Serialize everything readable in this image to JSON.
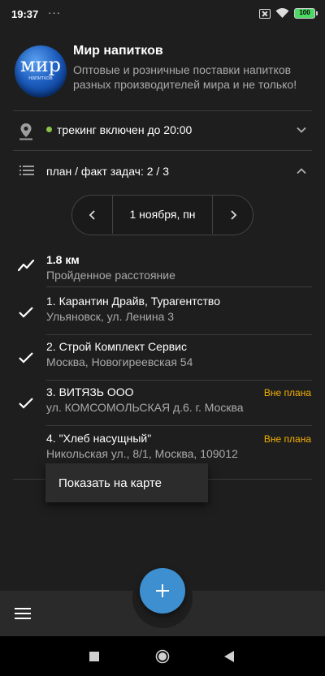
{
  "status_bar": {
    "time": "19:37",
    "dots": "···",
    "battery": "100"
  },
  "header": {
    "logo_main": "мир",
    "logo_sub": "напитков",
    "title": "Мир напитков",
    "description": "Оптовые и розничные поставки напитков разных производителей мира и не только!"
  },
  "tracking": {
    "icon": "location-pin-icon",
    "status_color": "#8bc34a",
    "text": "трекинг включен до 20:00"
  },
  "plan": {
    "icon": "list-icon",
    "text": "план / факт задач: 2 / 3"
  },
  "date_selector": {
    "label": "1 ноября, пн"
  },
  "distance": {
    "value": "1.8 км",
    "label": "Пройденное расстояние"
  },
  "tasks": [
    {
      "title": "1.  Карантин Драйв, Турагентство",
      "address": "Ульяновск, ул. Ленина 3",
      "badge": "",
      "done": true
    },
    {
      "title": "2.  Строй Комплект Сервис",
      "address": "Москва, Новогиреевская 54",
      "badge": "",
      "done": true
    },
    {
      "title": "3.  ВИТЯЗЬ ООО",
      "address": "ул. КОМСОМОЛЬСКАЯ  д.6. г. Москва",
      "badge": "Вне плана",
      "done": true
    },
    {
      "title": "4.  \"Хлеб насущный\"",
      "address": "Никольская ул., 8/1, Москва, 109012",
      "badge": "Вне плана",
      "done": false
    }
  ],
  "popup": {
    "item": "Показать на карте"
  },
  "colors": {
    "background": "#1e1e1e",
    "accent": "#3d8fcf",
    "badge": "#f5b100"
  }
}
